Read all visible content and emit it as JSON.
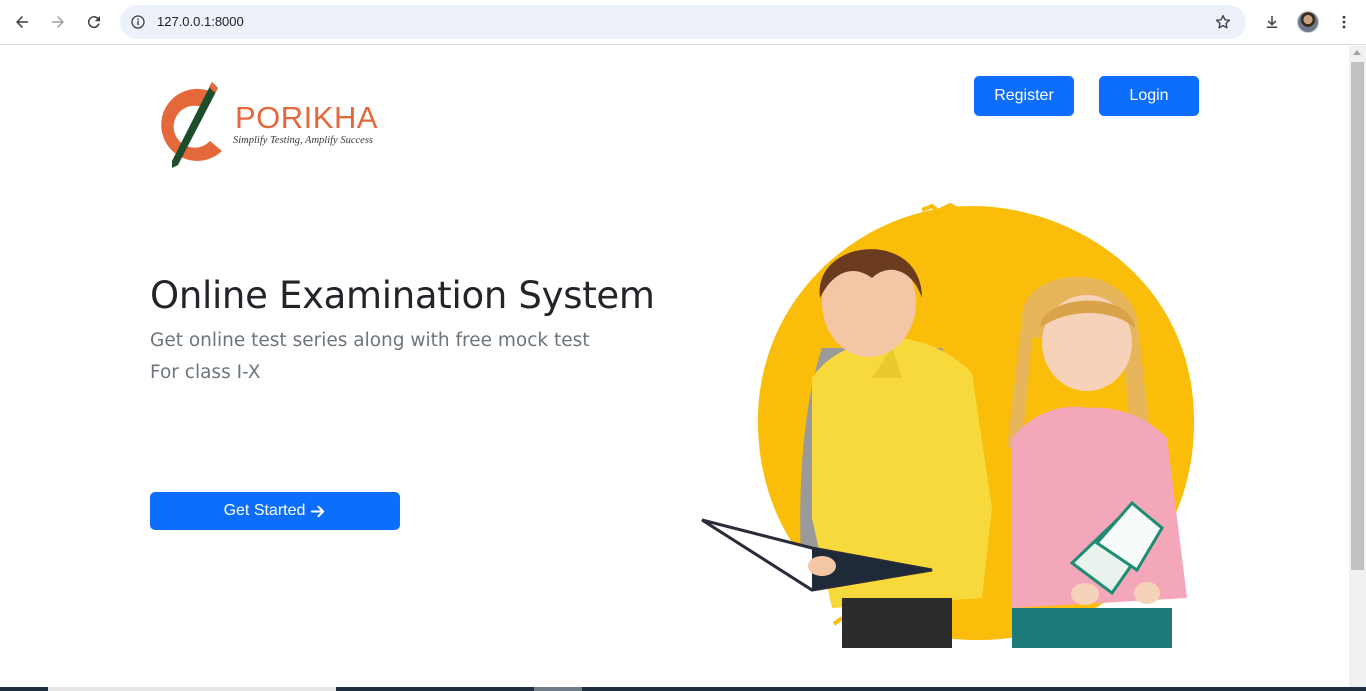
{
  "browser": {
    "url": "127.0.0.1:8000"
  },
  "logo": {
    "name": "PORIKHA",
    "tagline": "Simplify Testing, Amplify Success"
  },
  "header": {
    "register_label": "Register",
    "login_label": "Login"
  },
  "hero": {
    "title": "Online Examination System",
    "subtitle": "Get online test series along with free mock test",
    "subtitle2": "For class I-X",
    "cta_label": "Get Started",
    "cta_icon": "arrow-right-icon"
  },
  "colors": {
    "primary": "#0d6efd",
    "brand_orange": "#e4683a",
    "title": "#212529",
    "muted": "#6c757d",
    "hero_circle": "#f9bd0a"
  }
}
